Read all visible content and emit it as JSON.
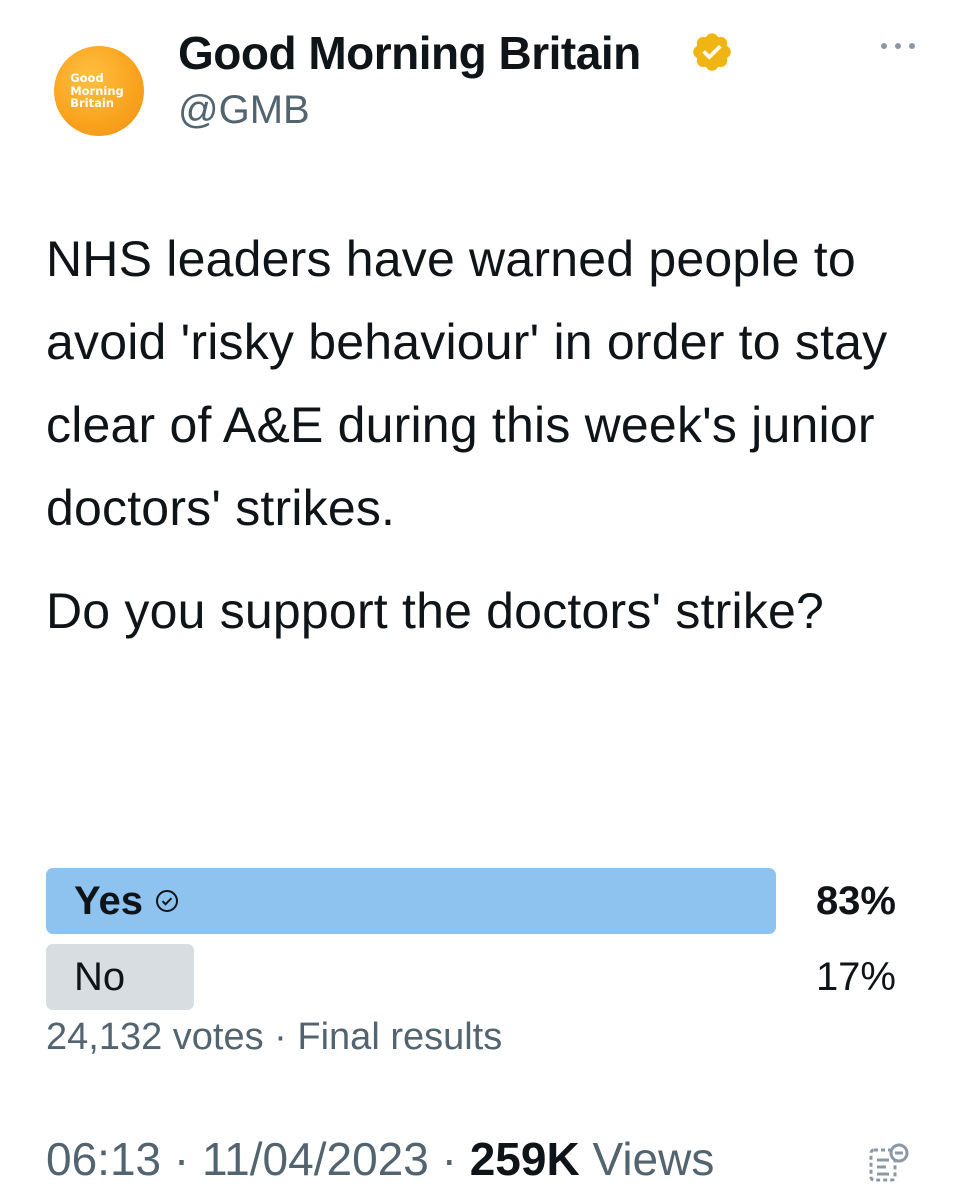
{
  "account": {
    "display_name": "Good Morning Britain",
    "handle": "@GMB",
    "avatar_text": "Good\nMorning\nBritain",
    "verified_icon": "verified-badge-icon",
    "verified_color": "#f0b513"
  },
  "tweet": {
    "body": "NHS leaders have warned people to avoid 'risky behaviour' in order to stay clear of A&E during this week's junior doctors' strikes.",
    "question": "Do you support the doctors' strike?"
  },
  "poll": {
    "options": [
      {
        "label": "Yes",
        "percent_label": "83%",
        "percent": 83,
        "winner": true,
        "bar_color": "#8ec3f0"
      },
      {
        "label": "No",
        "percent_label": "17%",
        "percent": 17,
        "winner": false,
        "bar_color": "#d8dde2"
      }
    ],
    "votes": "24,132 votes",
    "separator": "·",
    "status": "Final results"
  },
  "meta": {
    "time": "06:13",
    "date": "11/04/2023",
    "separator": "·",
    "views_count": "259K",
    "views_label": "Views"
  },
  "colors": {
    "text": "#0f1419",
    "secondary": "#536471",
    "avatar": "#f9a21c"
  }
}
